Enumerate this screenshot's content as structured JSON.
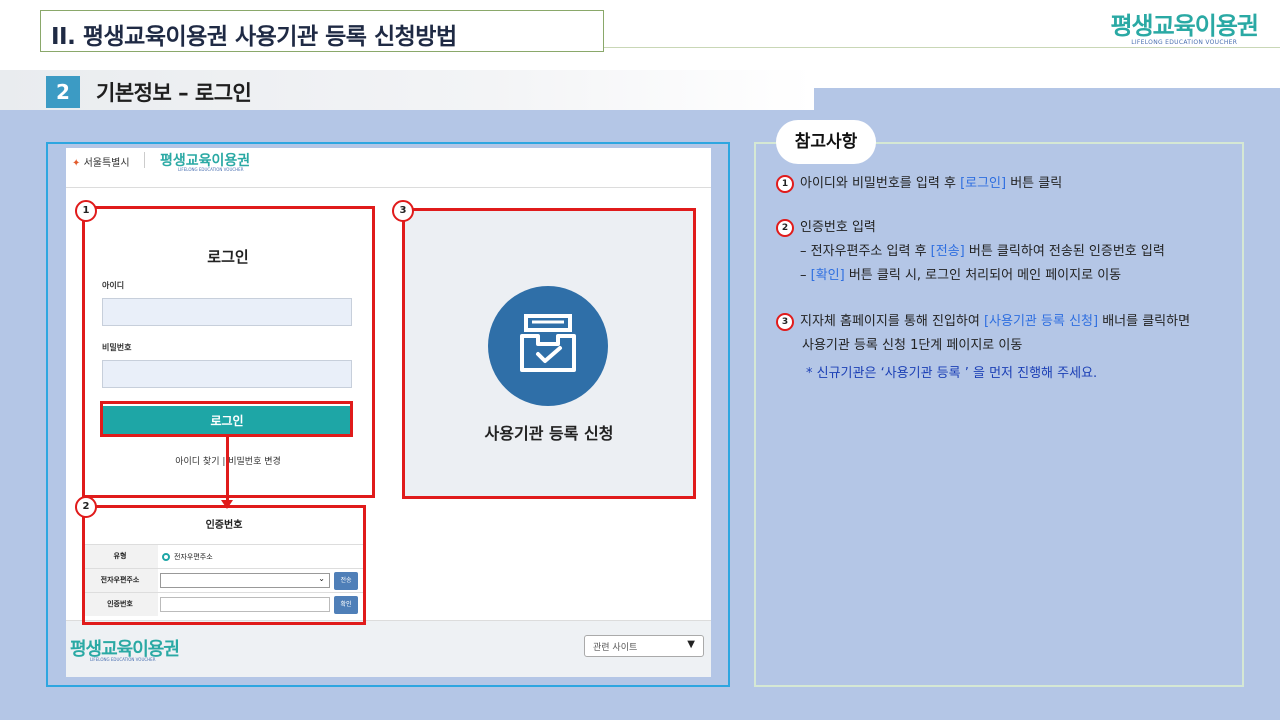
{
  "slide": {
    "title": "II. 평생교육이용권 사용기관 등록 신청방법",
    "brand_ko": "평생교육이용권",
    "brand_en": "LIFELONG EDUCATION VOUCHER",
    "section_number": "2",
    "section_title": "기본정보 – 로그인"
  },
  "screenshot": {
    "seoul_label": "서울특별시",
    "brand_ko": "평생교육이용권",
    "brand_en": "LIFELONG EDUCATION VOUCHER",
    "login": {
      "title": "로그인",
      "id_label": "아이디",
      "pw_label": "비밀번호",
      "button": "로그인",
      "find_links": "아이디 찾기 | 비밀번호 변경"
    },
    "apply": {
      "label": "사용기관 등록 신청"
    },
    "verify": {
      "title": "인증번호",
      "rows": [
        {
          "header": "유형",
          "value": "전자우편주소"
        },
        {
          "header": "전자우편주소",
          "button": "전송"
        },
        {
          "header": "인증번호",
          "button": "확인"
        }
      ]
    },
    "footer": {
      "brand_ko": "평생교육이용권",
      "brand_en": "LIFELONG EDUCATION VOUCHER",
      "related_sites": "관련 사이트"
    }
  },
  "badges": [
    "1",
    "2",
    "3"
  ],
  "notes": {
    "header": "참고사항",
    "item1": {
      "num": "1",
      "pre": "아이디와 비밀번호를 입력 후 ",
      "highlight": "[로그인]",
      "post": " 버튼 클릭"
    },
    "item2": {
      "num": "2",
      "text": "인증번호 입력",
      "sub1_pre": "– 전자우편주소 입력 후 ",
      "sub1_highlight": "[전송]",
      "sub1_post": " 버튼 클릭하여 전송된 인증번호 입력",
      "sub2_pre": "– ",
      "sub2_highlight": "[확인]",
      "sub2_post": " 버튼 클릭 시, 로그인 처리되어 메인 페이지로 이동"
    },
    "item3": {
      "num": "3",
      "pre": "지자체 홈페이지를 통해 진입하여 ",
      "highlight": "[사용기관 등록 신청]",
      "post": " 배너를 클릭하면",
      "line2": "사용기관 등록 신청 1단계 페이지로 이동",
      "star": "* 신규기관은 ‘사용기관 등록 ’ 을 먼저 진행해 주세요."
    }
  },
  "colors": {
    "accent_teal": "#1ea6a6",
    "highlight_red": "#e01b1b",
    "link_blue": "#2f6fe0",
    "background_blue": "#b4c6e6"
  }
}
